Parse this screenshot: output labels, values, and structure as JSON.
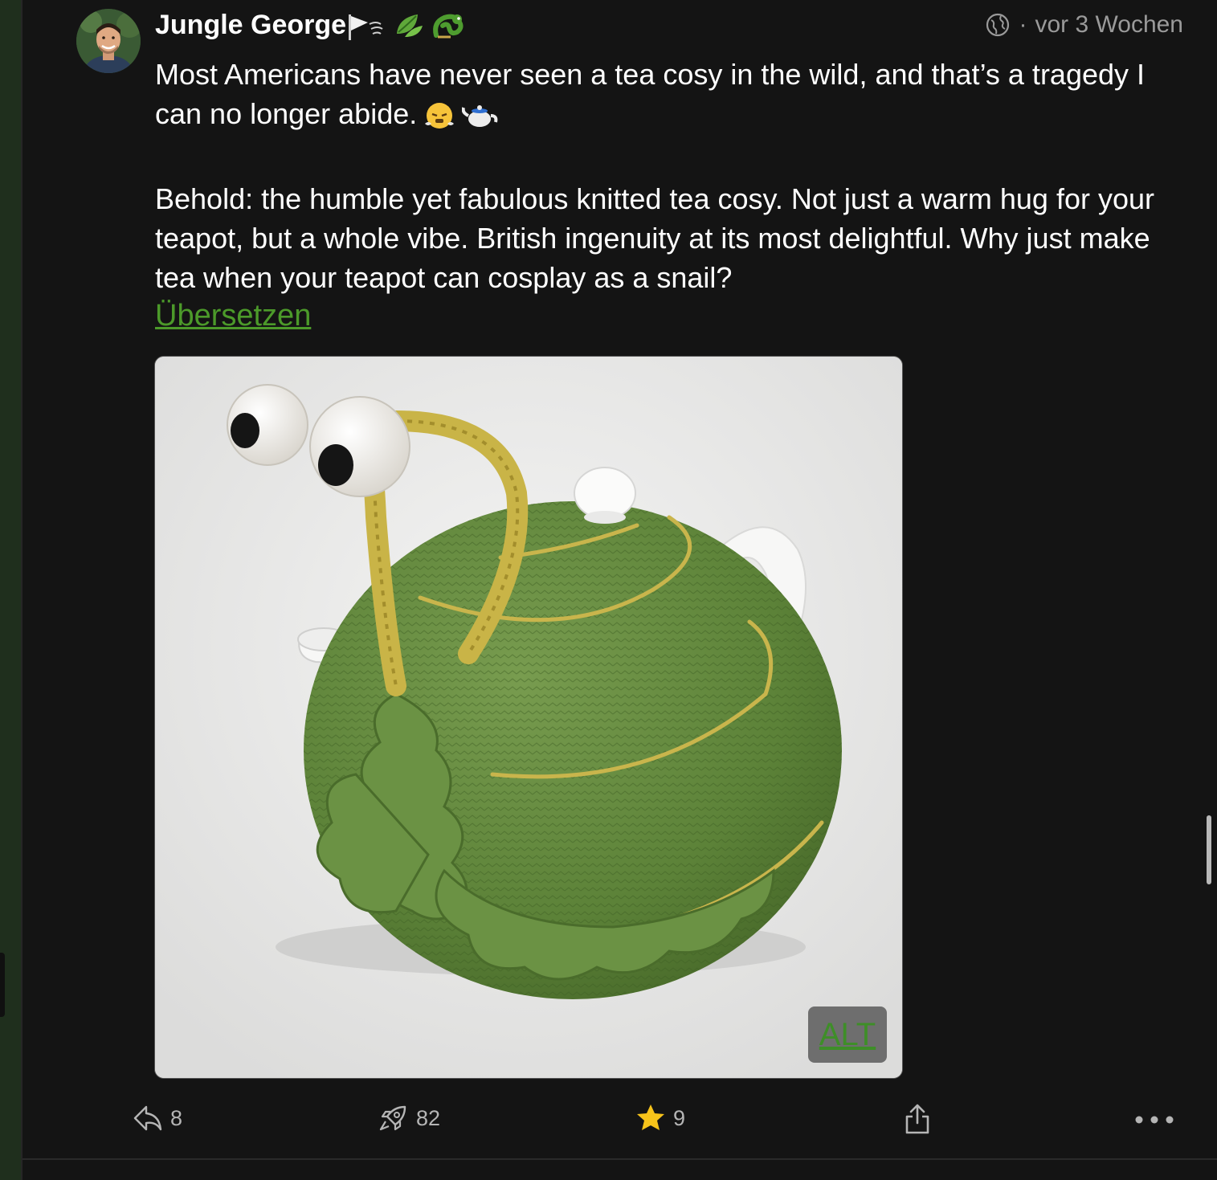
{
  "post": {
    "author": {
      "display_name": "Jungle George",
      "name_emojis": [
        "flag-emoji",
        "leaf-emoji",
        "dragon-emoji"
      ]
    },
    "visibility_icon": "globe-icon",
    "separator": "·",
    "timestamp": "vor 3 Wochen",
    "paragraph1": "Most Americans have never seen a tea cosy in the wild, and that’s a tragedy I can no longer abide.",
    "paragraph1_emojis": [
      "steam-face-emoji",
      "teapot-emoji"
    ],
    "paragraph2": "Behold: the humble yet fabulous knitted tea cosy. Not just a warm hug for your teapot, but a whole vibe. British ingenuity at its most delightful. Why just make tea when your teapot can cosplay as a snail?",
    "translate_label": "Übersetzen",
    "media": {
      "alt_badge": "ALT"
    },
    "actions": {
      "reply_count": "8",
      "boost_count": "82",
      "favourite_count": "9"
    }
  },
  "colors": {
    "background": "#141414",
    "link_green": "#4c9a2a",
    "star_yellow": "#f7c31a",
    "muted": "#9a9a9a"
  }
}
